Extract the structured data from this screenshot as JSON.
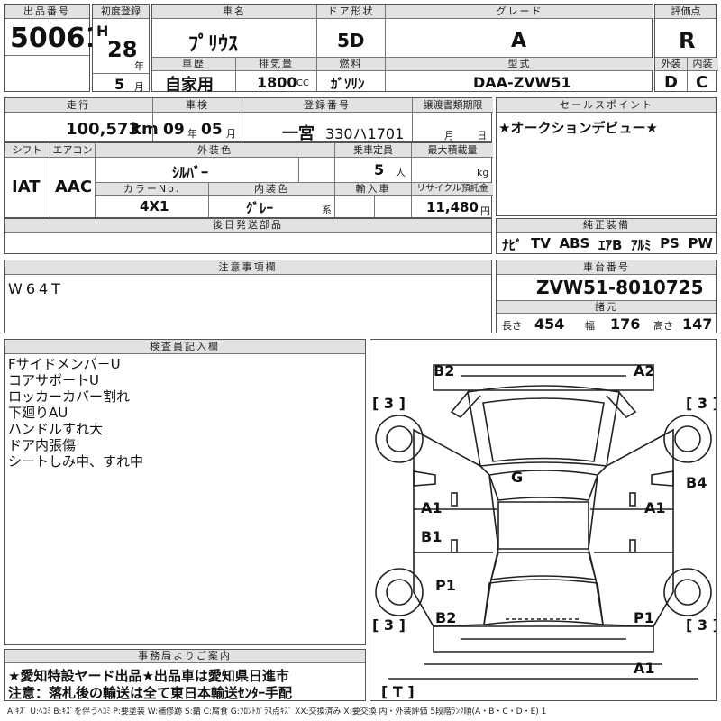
{
  "header": {
    "lot_label": "出品番号",
    "lot": "50061",
    "first_reg_label": "初度登録",
    "era": "H",
    "year": "28",
    "year_unit": "年",
    "month": "5",
    "month_unit": "月",
    "car_name_label": "車名",
    "car_name": "ﾌﾟﾘｳｽ",
    "history_label": "車歴",
    "history": "自家用",
    "disp_label": "排気量",
    "displacement": "1800",
    "disp_unit": "CC",
    "door_label": "ドア形状",
    "door": "5D",
    "fuel_label": "燃料",
    "fuel": "ｶﾞｿﾘﾝ",
    "grade_label": "グレード",
    "grade": "A",
    "model_label": "型式",
    "model": "DAA-ZVW51",
    "score_label": "評価点",
    "score": "R",
    "ext_label": "外装",
    "ext": "D",
    "int_label": "内装",
    "int": "C"
  },
  "row2": {
    "mileage_label": "走行",
    "mileage": "100,573",
    "mileage_unit": "km",
    "inspection_label": "車検",
    "insp_year": "09",
    "insp_year_unit": "年",
    "insp_month": "05",
    "insp_month_unit": "月",
    "plate_label": "登録番号",
    "plate_city": "一宮",
    "plate_no": "330ハ1701",
    "transfer_label": "譲渡書類期限",
    "transfer_month_unit": "月",
    "transfer_day_unit": "日"
  },
  "sales_point": {
    "label": "セールスポイント",
    "text": "★オークションデビュー★"
  },
  "row3": {
    "shift_label": "シフト",
    "shift": "IAT",
    "ac_label": "エアコン",
    "ac": "AAC",
    "ext_color_label": "外装色",
    "ext_color": "ｼﾙﾊﾞｰ",
    "capacity_label": "乗車定員",
    "capacity": "5",
    "capacity_unit": "人",
    "load_label": "最大積載量",
    "load_unit": "kg",
    "color_no_label": "カラーNo.",
    "color_no": "4X1",
    "int_color_label": "内装色",
    "int_color": "ｸﾞﾚｰ",
    "int_color_suffix": "系",
    "import_label": "輸入車",
    "recycle_label": "リサイクル預託金",
    "recycle": "11,480",
    "recycle_unit": "円"
  },
  "later_parts": {
    "label": "後日発送部品",
    "text": ""
  },
  "equipment": {
    "label": "純正装備",
    "items": [
      "ﾅﾋﾞ",
      "TV",
      "ABS",
      "ｴｱB",
      "ｱﾙﾐ",
      "PS",
      "PW"
    ]
  },
  "caution": {
    "label": "注意事項欄",
    "text": "W64T"
  },
  "chassis": {
    "label": "車台番号",
    "number": "ZVW51-8010725",
    "specs_label": "諸元",
    "length_label": "長さ",
    "length": "454",
    "width_label": "幅",
    "width": "176",
    "height_label": "高さ",
    "height": "147"
  },
  "inspector": {
    "label": "検査員記入欄",
    "notes": [
      "Fサイドメンバ－U",
      "コアサポートU",
      "ロッカーカバー割れ",
      "下廻りAU",
      "ハンドルすれ大",
      "ドア内張傷",
      "シートしみ中、すれ中"
    ]
  },
  "office": {
    "label": "事務局よりご案内",
    "line1": "★愛知特設ヤード出品★出品車は愛知県日進市",
    "line2": "注意：落札後の輸送は全て東日本輸送ｾﾝﾀｰ手配"
  },
  "diagram_marks": {
    "tl": "[ 3 ]",
    "tr": "[ 3 ]",
    "bl": "[ 3 ]",
    "br": "[ 3 ]",
    "bottom": "[ T ]",
    "b2_top": "B2",
    "a2_top": "A2",
    "g": "G",
    "b4": "B4",
    "a1_left": "A1",
    "a1_right": "A1",
    "b1_left": "B1",
    "p1_left": "P1",
    "b2_bottom": "B2",
    "p1_right": "P1",
    "a1_bottom": "A1"
  },
  "legend": "A:ｷｽﾞ U:ﾍｺﾐ B:ｷｽﾞを伴うﾍｺﾐ P:要塗装 W:補修跡 S:錆 C:腐食 G:ﾌﾛﾝﾄｶﾞﾗｽ点ｷｽﾞ XX:交換済み X:要交換 内・外装評価 5段階ﾗﾝｸ順(A・B・C・D・E) 1"
}
